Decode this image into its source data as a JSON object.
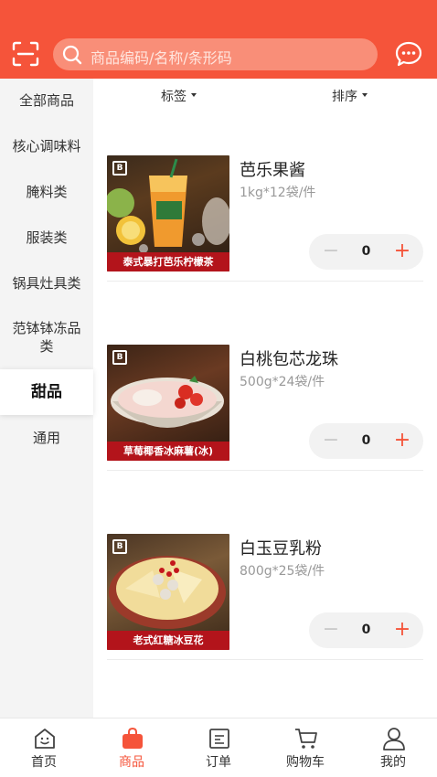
{
  "header": {
    "search_placeholder": "商品编码/名称/条形码",
    "accent_color": "#f5543a"
  },
  "sidebar": {
    "items": [
      {
        "label": "全部商品"
      },
      {
        "label": "核心调味料"
      },
      {
        "label": "腌料类"
      },
      {
        "label": "服装类"
      },
      {
        "label": "锅具灶具类"
      },
      {
        "label": "范钵钵冻品类"
      },
      {
        "label": "甜品",
        "active": true
      },
      {
        "label": "通用"
      }
    ]
  },
  "filters": {
    "tag_label": "标签",
    "sort_label": "排序"
  },
  "products": [
    {
      "name": "芭乐果酱",
      "spec": "1kg*12袋/件",
      "qty": "0",
      "image_caption": "泰式暴打芭乐柠檬茶",
      "image_logo": "B"
    },
    {
      "name": "白桃包芯龙珠",
      "spec": "500g*24袋/件",
      "qty": "0",
      "image_caption": "草莓椰香冰麻薯(冰)",
      "image_logo": "B"
    },
    {
      "name": "白玉豆乳粉",
      "spec": "800g*25袋/件",
      "qty": "0",
      "image_caption": "老式红糖冰豆花",
      "image_logo": "B"
    }
  ],
  "stepper": {
    "minus_symbol": "−",
    "plus_symbol": "+"
  },
  "tabbar": {
    "tabs": [
      {
        "label": "首页",
        "icon": "home-icon"
      },
      {
        "label": "商品",
        "icon": "shopping-bag-icon",
        "active": true
      },
      {
        "label": "订单",
        "icon": "order-list-icon"
      },
      {
        "label": "购物车",
        "icon": "cart-icon"
      },
      {
        "label": "我的",
        "icon": "user-icon"
      }
    ]
  }
}
